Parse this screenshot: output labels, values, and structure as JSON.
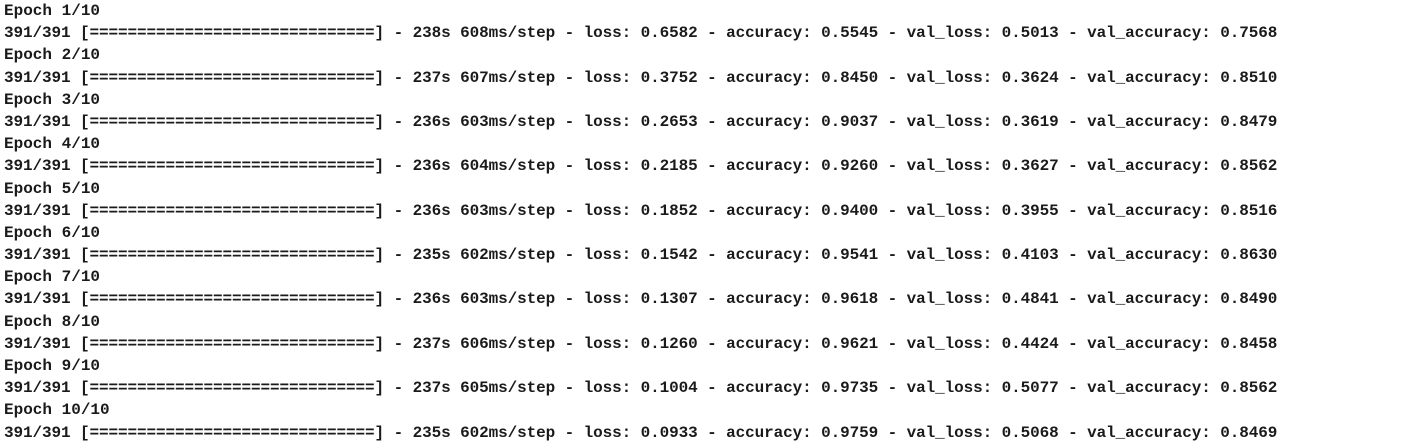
{
  "epochs": [
    {
      "header": "Epoch 1/10",
      "progress": "391/391 [==============================] - 238s 608ms/step - loss: 0.6582 - accuracy: 0.5545 - val_loss: 0.5013 - val_accuracy: 0.7568"
    },
    {
      "header": "Epoch 2/10",
      "progress": "391/391 [==============================] - 237s 607ms/step - loss: 0.3752 - accuracy: 0.8450 - val_loss: 0.3624 - val_accuracy: 0.8510"
    },
    {
      "header": "Epoch 3/10",
      "progress": "391/391 [==============================] - 236s 603ms/step - loss: 0.2653 - accuracy: 0.9037 - val_loss: 0.3619 - val_accuracy: 0.8479"
    },
    {
      "header": "Epoch 4/10",
      "progress": "391/391 [==============================] - 236s 604ms/step - loss: 0.2185 - accuracy: 0.9260 - val_loss: 0.3627 - val_accuracy: 0.8562"
    },
    {
      "header": "Epoch 5/10",
      "progress": "391/391 [==============================] - 236s 603ms/step - loss: 0.1852 - accuracy: 0.9400 - val_loss: 0.3955 - val_accuracy: 0.8516"
    },
    {
      "header": "Epoch 6/10",
      "progress": "391/391 [==============================] - 235s 602ms/step - loss: 0.1542 - accuracy: 0.9541 - val_loss: 0.4103 - val_accuracy: 0.8630"
    },
    {
      "header": "Epoch 7/10",
      "progress": "391/391 [==============================] - 236s 603ms/step - loss: 0.1307 - accuracy: 0.9618 - val_loss: 0.4841 - val_accuracy: 0.8490"
    },
    {
      "header": "Epoch 8/10",
      "progress": "391/391 [==============================] - 237s 606ms/step - loss: 0.1260 - accuracy: 0.9621 - val_loss: 0.4424 - val_accuracy: 0.8458"
    },
    {
      "header": "Epoch 9/10",
      "progress": "391/391 [==============================] - 237s 605ms/step - loss: 0.1004 - accuracy: 0.9735 - val_loss: 0.5077 - val_accuracy: 0.8562"
    },
    {
      "header": "Epoch 10/10",
      "progress": "391/391 [==============================] - 235s 602ms/step - loss: 0.0933 - accuracy: 0.9759 - val_loss: 0.5068 - val_accuracy: 0.8469"
    }
  ]
}
